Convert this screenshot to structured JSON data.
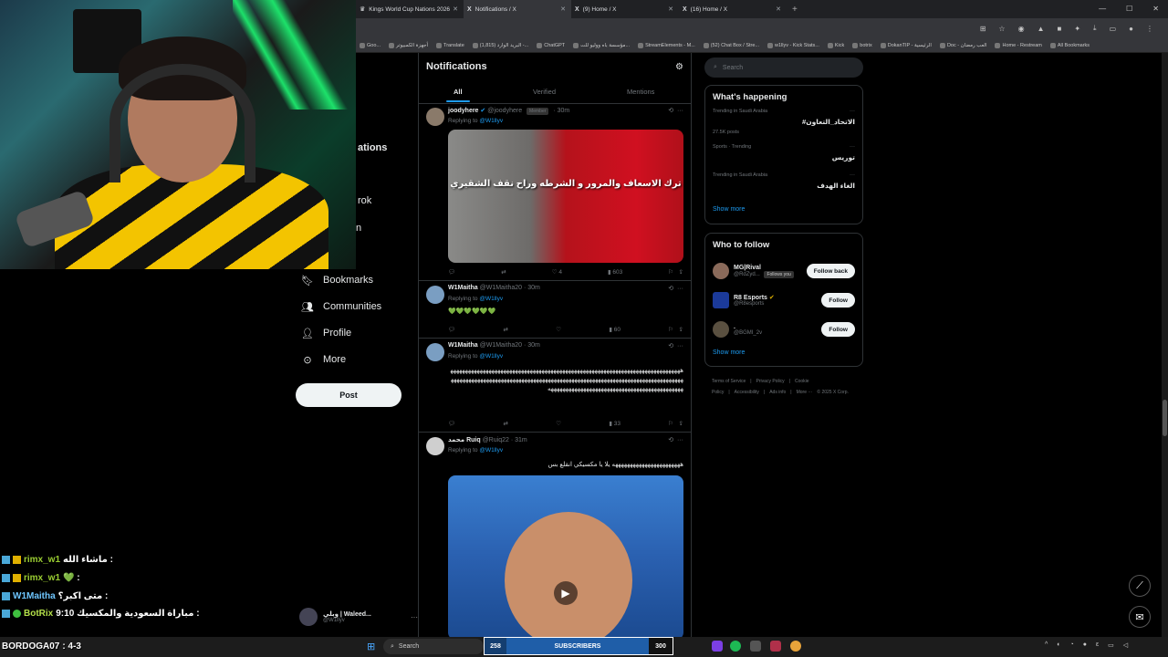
{
  "browser": {
    "tabs": [
      {
        "label": "Kings World Cup Nations 2026",
        "icon": "kings-icon",
        "active": false
      },
      {
        "label": "Notifications / X",
        "icon": "x-logo-icon",
        "active": true
      },
      {
        "label": "(9) Home / X",
        "icon": "x-logo-icon",
        "active": false
      },
      {
        "label": "(16) Home / X",
        "icon": "x-logo-icon",
        "active": false
      }
    ],
    "bookmarks": [
      "Goo...",
      "أجهزة الكمبيوتر",
      "Translate",
      "(1,815) البريد الوارد -...",
      "ChatGPT",
      "مؤسسة باه ووليو للت...",
      "StreamElements - M...",
      "(52) Chat Box / Stre...",
      "w1llyv - Kick Stats...",
      "Kick",
      "botrix",
      "DokanTIP - الرئيسية",
      "Doc - العب رمضان",
      "Home - Restream",
      "All Bookmarks"
    ]
  },
  "nav": {
    "partial_items": [
      "ations",
      "rok",
      "n"
    ],
    "bookmarks": "Bookmarks",
    "communities": "Communities",
    "profile": "Profile",
    "more": "More",
    "post": "Post",
    "account_name": "وبلي | Waleed...",
    "account_handle": "@W1llyv"
  },
  "notifications": {
    "title": "Notifications",
    "tabs": [
      "All",
      "Verified",
      "Mentions"
    ],
    "tweets": [
      {
        "name": "joodyhere",
        "handle": "@joodyhere",
        "badge": "Member",
        "time": "· 30m",
        "replying": "Replying to",
        "to": "@W1llyv",
        "media_caption": "ترك الاسعاف والمرور و الشرطه وراح نقف الشقيري",
        "likes": "4",
        "views": "603"
      },
      {
        "name": "W1Maitha",
        "handle": "@W1Maitha20",
        "time": "· 30m",
        "replying": "Replying to",
        "to": "@W1llyv",
        "text": "💚💚💚💚💚💚",
        "views": "60"
      },
      {
        "name": "W1Maitha",
        "handle": "@W1Maitha20",
        "time": "· 30m",
        "replying": "Replying to",
        "to": "@W1llyv",
        "text": "هههههههههههههههههههههههههههههههههههههههههههههههههههههههههههههههههههههههههههههههههههههههههههههههههههههههههههههههههههههههههههههههههههههههههههههههههههههههههههههههههههههههههههههههههههههههههههههههههههههههههههه",
        "views": "33"
      },
      {
        "name": "محمد Ruiq",
        "handle": "@Ruiq22",
        "time": "· 31m",
        "replying": "Replying to",
        "to": "@W1llyv",
        "text": "هههههههههههههههههههههههه يلا يا مكسيكي انقلع بس"
      }
    ]
  },
  "right": {
    "search_placeholder": "Search",
    "happening_title": "What's happening",
    "trends": [
      {
        "context": "Trending in Saudi Arabia",
        "topic": "#الاتحاد_التعاون",
        "posts": "27.5K posts"
      },
      {
        "context": "Sports · Trending",
        "topic": "توريس",
        "posts": ""
      },
      {
        "context": "Trending in Saudi Arabia",
        "topic": "الغاء الهدف",
        "posts": ""
      }
    ],
    "show_more": "Show more",
    "follow_title": "Who to follow",
    "follow": [
      {
        "name": "MG|Rival",
        "handle": "@RdZyd...",
        "extra": "Follows you",
        "button": "Follow back"
      },
      {
        "name": "R8 Esports",
        "handle": "@R8esports",
        "extra": "",
        "button": "Follow"
      },
      {
        "name": ".",
        "handle": "@BGMI_2v",
        "extra": "",
        "button": "Follow"
      }
    ],
    "footer": [
      "Terms of Service",
      "|",
      "Privacy Policy",
      "|",
      "Cookie Policy",
      "|",
      "Accessibility",
      "|",
      "Ads info",
      "|",
      "More ···",
      "© 2025 X Corp."
    ]
  },
  "chat": [
    {
      "name": "rimx_w1",
      "message": "ماشاء الله :"
    },
    {
      "name": "rimx_w1",
      "message": "💚 :"
    },
    {
      "name": "W1Maitha",
      "message": "متى اكبر؟ :"
    },
    {
      "name": "BotRix",
      "message": "مباراة السعودية والمكسيك 9:10 :"
    },
    {
      "name": "BORDOGA07",
      "message": ": 4-3"
    }
  ],
  "taskbar": {
    "search": "Search",
    "subs_left": "258",
    "subs_label": "SUBSCRIBERS",
    "subs_right": "300"
  },
  "colors": {
    "accent": "#1d9bf0",
    "background": "#000000",
    "chat_name": "#9acd32"
  }
}
